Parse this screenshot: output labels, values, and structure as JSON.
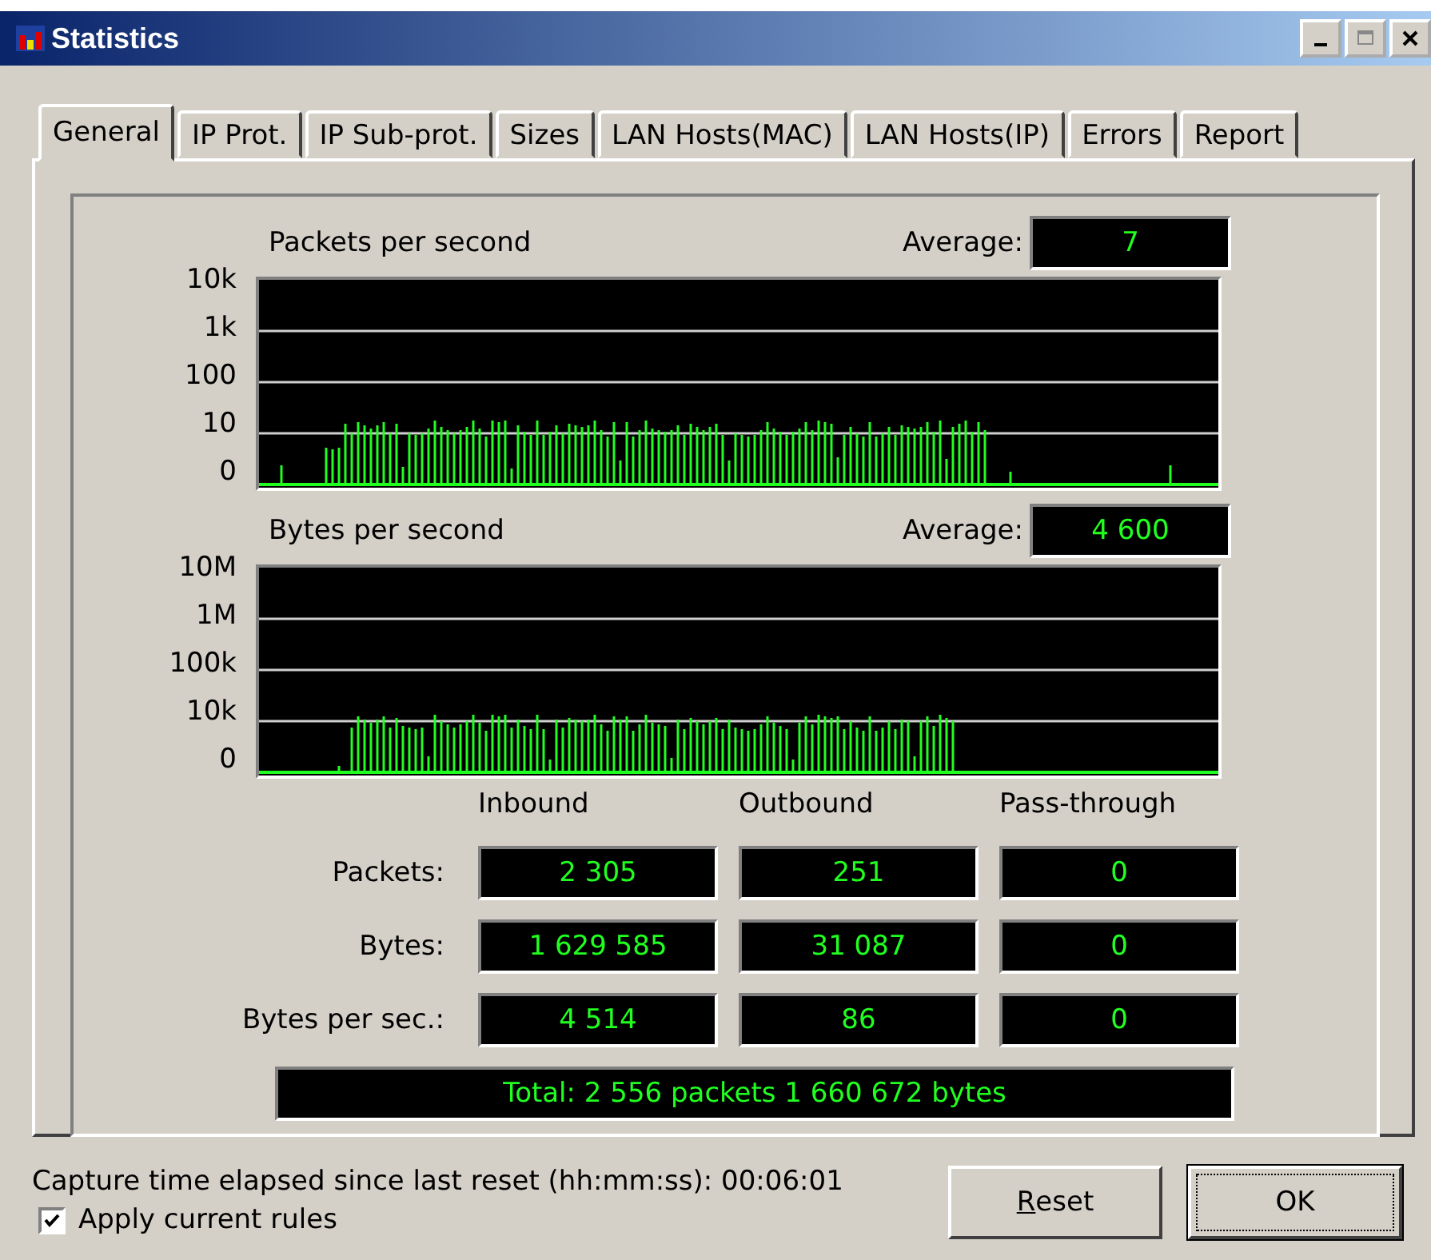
{
  "window": {
    "title": "Statistics"
  },
  "tabs": [
    {
      "label": "General",
      "selected": true
    },
    {
      "label": "IP Prot.",
      "selected": false
    },
    {
      "label": "IP Sub-prot.",
      "selected": false
    },
    {
      "label": "Sizes",
      "selected": false
    },
    {
      "label": "LAN Hosts(MAC)",
      "selected": false
    },
    {
      "label": "LAN Hosts(IP)",
      "selected": false
    },
    {
      "label": "Errors",
      "selected": false
    },
    {
      "label": "Report",
      "selected": false
    }
  ],
  "graphs": [
    {
      "title": "Packets per second",
      "average_label": "Average:",
      "average": "7",
      "y_labels": [
        "10k",
        "1k",
        "100",
        "10",
        "0"
      ],
      "kind": "packets"
    },
    {
      "title": "Bytes per second",
      "average_label": "Average:",
      "average": "4 600",
      "y_labels": [
        "10M",
        "1M",
        "100k",
        "10k",
        "0"
      ],
      "kind": "bytes"
    }
  ],
  "counters": {
    "columns": [
      "Inbound",
      "Outbound",
      "Pass-through"
    ],
    "rows": [
      {
        "label": "Packets:",
        "values": [
          "2 305",
          "251",
          "0"
        ]
      },
      {
        "label": "Bytes:",
        "values": [
          "1 629 585",
          "31 087",
          "0"
        ]
      },
      {
        "label": "Bytes per sec.:",
        "values": [
          "4 514",
          "86",
          "0"
        ]
      }
    ],
    "total": "Total: 2 556 packets 1 660 672 bytes"
  },
  "status": {
    "elapsed": "Capture time elapsed since last reset (hh:mm:ss): 00:06:01"
  },
  "apply_rules": {
    "label": "Apply current rules",
    "checked": true
  },
  "buttons": [
    {
      "label_parts": [
        {
          "text": "R",
          "underlined": true
        },
        {
          "text": "eset",
          "underlined": false
        }
      ],
      "default": false
    },
    {
      "label_parts": [
        {
          "text": "OK",
          "underlined": false
        }
      ],
      "default": true
    }
  ]
}
